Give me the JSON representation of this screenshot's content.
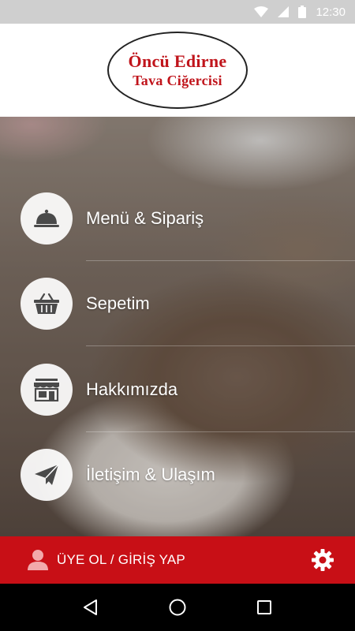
{
  "status_bar": {
    "time": "12:30",
    "icons": [
      "wifi-icon",
      "signal-icon",
      "battery-icon"
    ]
  },
  "header": {
    "logo_line1": "Öncü Edirne",
    "logo_line2": "Tava Ciğercisi"
  },
  "menu": {
    "items": [
      {
        "label": "Menü & Sipariş",
        "icon": "food-cloche-icon"
      },
      {
        "label": "Sepetim",
        "icon": "basket-icon"
      },
      {
        "label": "Hakkımızda",
        "icon": "store-icon"
      },
      {
        "label": "İletişim & Ulaşım",
        "icon": "paper-plane-icon"
      }
    ]
  },
  "user_bar": {
    "login_label": "ÜYE OL / GİRİŞ YAP",
    "icons": [
      "user-icon",
      "gear-icon"
    ]
  },
  "nav_bar": {
    "icons": [
      "back-icon",
      "home-icon",
      "recents-icon"
    ]
  },
  "colors": {
    "brand_red": "#c80f16",
    "logo_red": "#c0141b",
    "icon_gray": "#4a4a4a"
  }
}
